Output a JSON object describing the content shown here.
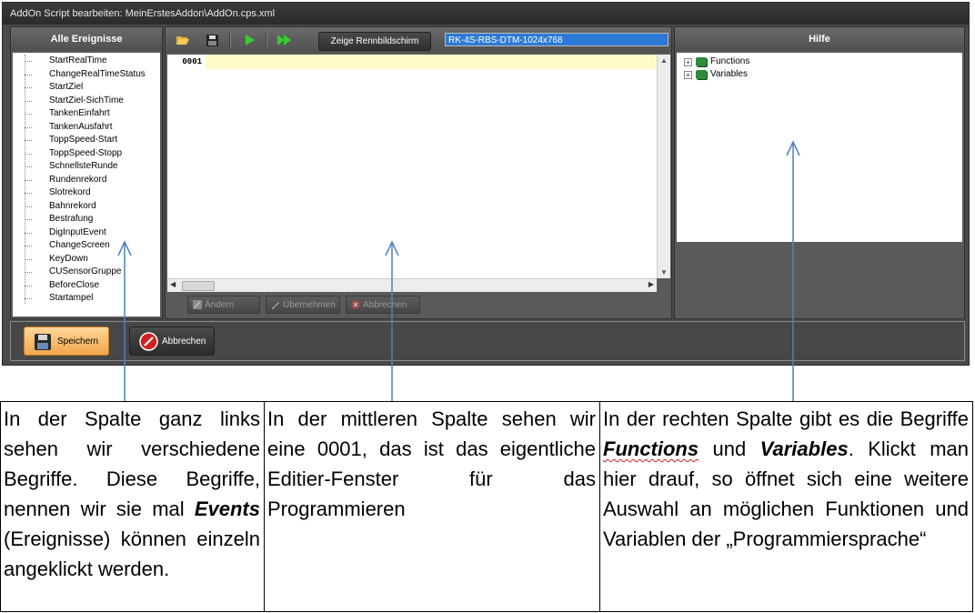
{
  "window": {
    "title": "AddOn Script bearbeiten: MeinErstesAddon\\AddOn.cps.xml"
  },
  "left_panel": {
    "title": "Alle Ereignisse",
    "events": [
      "StartRealTime",
      "ChangeRealTimeStatus",
      "StartZiel",
      "StartZiel-SichTime",
      "TankenEinfahrt",
      "TankenAusfahrt",
      "ToppSpeed-Start",
      "ToppSpeed-Stopp",
      "SchnellsteRunde",
      "Rundenrekord",
      "Slotrekord",
      "Bahnrekord",
      "Bestrafung",
      "DigInputEvent",
      "ChangeScreen",
      "KeyDown",
      "CUSensorGruppe",
      "BeforeClose",
      "Startampel"
    ]
  },
  "middle_panel": {
    "show_button": "Zeige Rennbildschirm",
    "profile_value": "RK-4S-RBS-DTM-1024x768",
    "line_number": "0001",
    "buttons": {
      "change": "Ändern",
      "apply": "Übernehmen",
      "cancel": "Abbrechen"
    }
  },
  "right_panel": {
    "title": "Hilfe",
    "items": [
      "Functions",
      "Variables"
    ]
  },
  "bottom_bar": {
    "save": "Speichern",
    "cancel": "Abbrechen"
  },
  "descriptions": {
    "left": {
      "p1": "In der Spalte ganz links sehen wir verschiedene Begriffe. Diese Begriffe, nennen wir sie mal ",
      "events_word": "Events",
      "p2": " (Ereignisse) können einzeln angeklickt werden."
    },
    "middle": {
      "text": "In der mittleren Spalte sehen wir eine 0001, das ist das eigentliche Editier-Fenster für das Programmieren"
    },
    "right": {
      "p1": "In der rechten Spalte gibt es die Begriffe ",
      "functions_word": "Functions",
      "p2": " und ",
      "variables_word": "Variables",
      "p3": ". Klickt man hier drauf, so öffnet sich eine weitere Auswahl an möglichen Funktionen und Variablen der „Programmiersprache“"
    }
  },
  "colors": {
    "arrow": "#4f81bd",
    "selection": "#2d7ad6",
    "current_line": "#fffbc8"
  }
}
